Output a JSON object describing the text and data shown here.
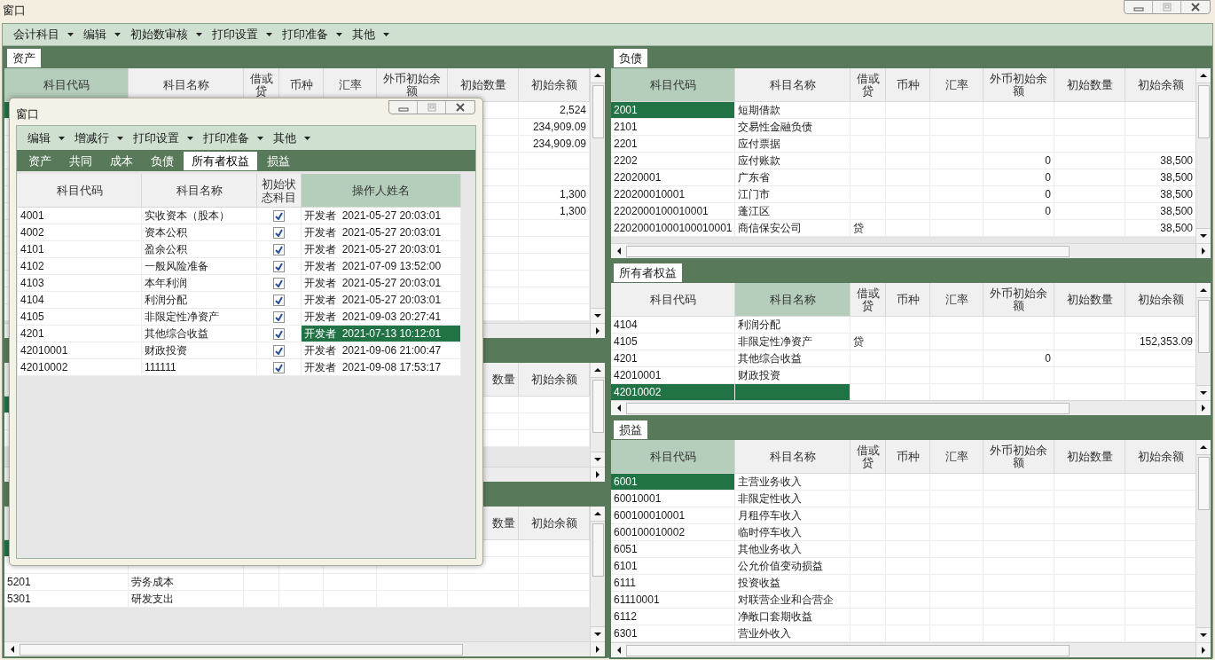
{
  "window": {
    "title": "窗口"
  },
  "menu": [
    "会计科目",
    "编辑",
    "初始数审核",
    "打印设置",
    "打印准备",
    "其他"
  ],
  "left_panels": [
    {
      "tab": "资产",
      "columns": [
        {
          "label": "科目代码",
          "selected": true
        },
        {
          "label": "科目名称",
          "selected": false
        },
        {
          "label": "借或贷",
          "selected": false
        },
        {
          "label": "币种",
          "selected": false
        },
        {
          "label": "汇率",
          "selected": false
        },
        {
          "label": "外币初始余额",
          "selected": false
        },
        {
          "label": "初始数量",
          "selected": false
        },
        {
          "label": "初始余额",
          "selected": false
        }
      ],
      "rows": [
        {
          "selected": true,
          "balance": "2,524"
        },
        {
          "selected": false,
          "balance": "234,909.09"
        },
        {
          "selected": false,
          "balance": "234,909.09"
        },
        {
          "selected": false
        },
        {
          "selected": false
        },
        {
          "selected": false,
          "balance": "1,300"
        },
        {
          "selected": false,
          "balance": "1,300"
        },
        {
          "selected": false
        },
        {
          "selected": false
        },
        {
          "selected": false
        },
        {
          "selected": false
        },
        {
          "selected": false
        },
        {
          "selected": false
        }
      ]
    },
    {
      "columns": [
        {
          "label": "数量",
          "selected": false
        },
        {
          "label": "初始余额",
          "selected": false
        }
      ],
      "rows": [
        {
          "selected": true
        },
        {
          "selected": false
        },
        {
          "selected": false
        }
      ]
    },
    {
      "columns": [
        {
          "label": "数量",
          "selected": false
        },
        {
          "label": "初始余额",
          "selected": false
        }
      ],
      "rows": [
        {
          "selected": true
        },
        {
          "selected": false
        },
        {
          "selected": false,
          "code": "5201",
          "name": "劳务成本"
        },
        {
          "selected": false,
          "code": "5301",
          "name": "研发支出"
        }
      ]
    }
  ],
  "right_panels": [
    {
      "tab": "负债",
      "columns": [
        {
          "label": "科目代码",
          "selected": true
        },
        {
          "label": "科目名称",
          "selected": false
        },
        {
          "label": "借或贷",
          "selected": false
        },
        {
          "label": "币种",
          "selected": false
        },
        {
          "label": "汇率",
          "selected": false
        },
        {
          "label": "外币初始余额",
          "selected": false
        },
        {
          "label": "初始数量",
          "selected": false
        },
        {
          "label": "初始余额",
          "selected": false
        }
      ],
      "rows": [
        {
          "selected": true,
          "code": "2001",
          "name": "短期借款"
        },
        {
          "selected": false,
          "code": "2101",
          "name": "交易性金融负债"
        },
        {
          "selected": false,
          "code": "2201",
          "name": "应付票据"
        },
        {
          "selected": false,
          "code": "2202",
          "name": "应付账款",
          "fc_balance": "0",
          "balance": "38,500"
        },
        {
          "selected": false,
          "code": "22020001",
          "name": "广东省",
          "fc_balance": "0",
          "balance": "38,500"
        },
        {
          "selected": false,
          "code": "220200010001",
          "name": "江门市",
          "fc_balance": "0",
          "balance": "38,500"
        },
        {
          "selected": false,
          "code": "2202000100010001",
          "name": "蓬江区",
          "fc_balance": "0",
          "balance": "38,500"
        },
        {
          "selected": false,
          "code": "22020001000100010001",
          "name": "商信保安公司",
          "dc": "贷",
          "balance": "38,500"
        }
      ]
    },
    {
      "tab": "所有者权益",
      "columns": [
        {
          "label": "科目代码",
          "selected": false
        },
        {
          "label": "科目名称",
          "selected": true
        },
        {
          "label": "借或贷",
          "selected": false
        },
        {
          "label": "币种",
          "selected": false
        },
        {
          "label": "汇率",
          "selected": false
        },
        {
          "label": "外币初始余额",
          "selected": false
        },
        {
          "label": "初始数量",
          "selected": false
        },
        {
          "label": "初始余额",
          "selected": false
        }
      ],
      "rows": [
        {
          "selected": false,
          "code": "4104",
          "name": "利润分配"
        },
        {
          "selected": false,
          "code": "4105",
          "name": "非限定性净资产",
          "dc": "贷",
          "balance": "152,353.09"
        },
        {
          "selected": false,
          "code": "4201",
          "name": "其他综合收益",
          "fc_balance": "0"
        },
        {
          "selected": false,
          "code": "42010001",
          "name": "财政投资"
        },
        {
          "selected": true,
          "code": "42010002"
        }
      ]
    },
    {
      "tab": "损益",
      "columns": [
        {
          "label": "科目代码",
          "selected": true
        },
        {
          "label": "科目名称",
          "selected": false
        },
        {
          "label": "借或贷",
          "selected": false
        },
        {
          "label": "币种",
          "selected": false
        },
        {
          "label": "汇率",
          "selected": false
        },
        {
          "label": "外币初始余额",
          "selected": false
        },
        {
          "label": "初始数量",
          "selected": false
        },
        {
          "label": "初始余额",
          "selected": false
        }
      ],
      "rows": [
        {
          "selected": true,
          "code": "6001",
          "name": "主营业务收入"
        },
        {
          "selected": false,
          "code": "60010001",
          "name": "非限定性收入"
        },
        {
          "selected": false,
          "code": "600100010001",
          "name": "月租停车收入"
        },
        {
          "selected": false,
          "code": "600100010002",
          "name": "临时停车收入"
        },
        {
          "selected": false,
          "code": "6051",
          "name": "其他业务收入"
        },
        {
          "selected": false,
          "code": "6101",
          "name": "公允价值变动损益"
        },
        {
          "selected": false,
          "code": "6111",
          "name": "投资收益"
        },
        {
          "selected": false,
          "code": "61110001",
          "name": "对联营企业和合营企"
        },
        {
          "selected": false,
          "code": "6112",
          "name": "净敞口套期收益"
        },
        {
          "selected": false,
          "code": "6301",
          "name": "营业外收入"
        }
      ]
    }
  ],
  "dialog": {
    "title": "窗口",
    "menu": [
      "编辑",
      "增减行",
      "打印设置",
      "打印准备",
      "其他"
    ],
    "tabs": [
      {
        "label": "资产",
        "selected": false
      },
      {
        "label": "共同",
        "selected": false
      },
      {
        "label": "成本",
        "selected": false
      },
      {
        "label": "负债",
        "selected": false
      },
      {
        "label": "所有者权益",
        "selected": true
      },
      {
        "label": "损益",
        "selected": false
      }
    ],
    "columns": [
      {
        "label": "科目代码",
        "selected": false
      },
      {
        "label": "科目名称",
        "selected": false
      },
      {
        "label": "初始状态科目",
        "selected": false
      },
      {
        "label": "操作人姓名",
        "selected": true
      }
    ],
    "rows": [
      {
        "code": "4001",
        "name": "实收资本（股本）",
        "initial": true,
        "operator": "开发者  2021-05-27 20:03:01",
        "selected": false
      },
      {
        "code": "4002",
        "name": "资本公积",
        "initial": true,
        "operator": "开发者  2021-05-27 20:03:01",
        "selected": false
      },
      {
        "code": "4101",
        "name": "盈余公积",
        "initial": true,
        "operator": "开发者  2021-05-27 20:03:01",
        "selected": false
      },
      {
        "code": "4102",
        "name": "一般风险准备",
        "initial": true,
        "operator": "开发者  2021-07-09 13:52:00",
        "selected": false
      },
      {
        "code": "4103",
        "name": "本年利润",
        "initial": true,
        "operator": "开发者  2021-05-27 20:03:01",
        "selected": false
      },
      {
        "code": "4104",
        "name": "利润分配",
        "initial": true,
        "operator": "开发者  2021-05-27 20:03:01",
        "selected": false
      },
      {
        "code": "4105",
        "name": "非限定性净资产",
        "initial": true,
        "operator": "开发者  2021-09-03 20:27:41",
        "selected": false
      },
      {
        "code": "4201",
        "name": "其他综合收益",
        "initial": true,
        "operator": "开发者  2021-07-13 10:12:01",
        "selected": true
      },
      {
        "code": "42010001",
        "name": "财政投资",
        "initial": true,
        "operator": "开发者  2021-09-06 21:00:47",
        "selected": false
      },
      {
        "code": "42010002",
        "name": "111111",
        "initial": true,
        "operator": "开发者  2021-09-08 17:53:17",
        "selected": false
      }
    ]
  }
}
